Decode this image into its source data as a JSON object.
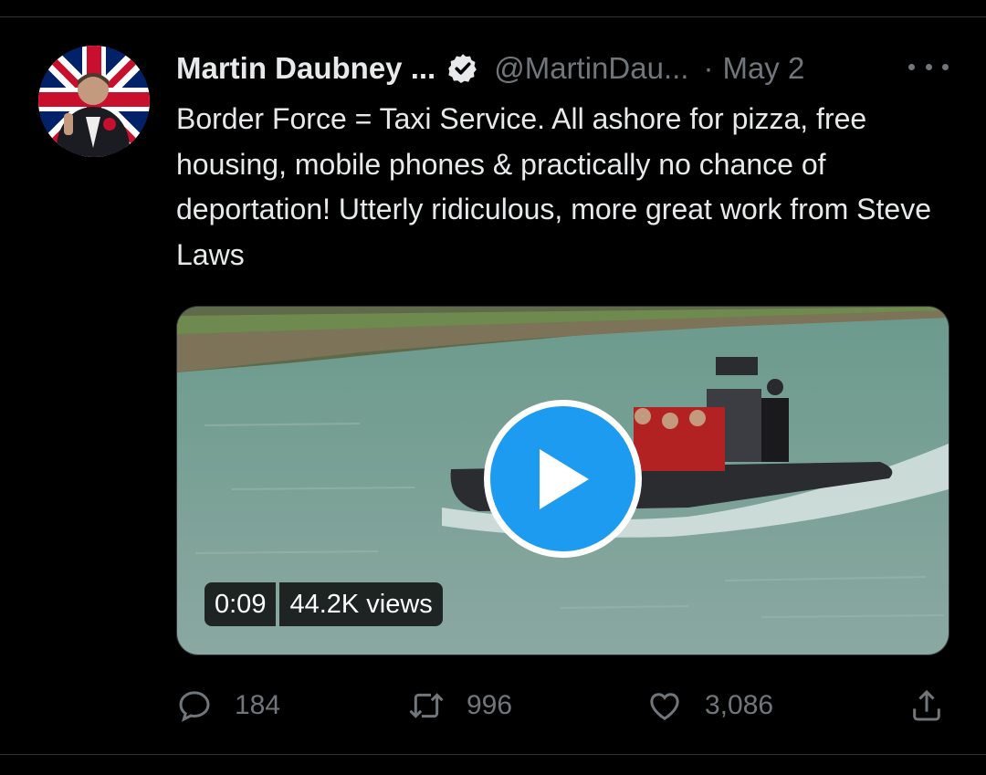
{
  "tweet": {
    "author_name": "Martin Daubney ...",
    "handle": "@MartinDau...",
    "separator": "·",
    "date": "May 2",
    "text": "Border Force = Taxi Service. All ashore for pizza, free housing, mobile phones & practically no chance of deportation! Utterly ridiculous, more great work from Steve Laws",
    "verified": true
  },
  "media": {
    "duration": "0:09",
    "views": "44.2K views"
  },
  "actions": {
    "replies": "184",
    "retweets": "996",
    "likes": "3,086"
  },
  "colors": {
    "background": "#000000",
    "text_primary": "#e7e9ea",
    "text_secondary": "#71767b",
    "accent": "#1d9bf0"
  },
  "icons": {
    "verified": "verified-badge-icon",
    "more": "more-horizontal-icon",
    "play": "play-icon",
    "reply": "reply-icon",
    "retweet": "retweet-icon",
    "like": "heart-icon",
    "share": "share-icon"
  }
}
